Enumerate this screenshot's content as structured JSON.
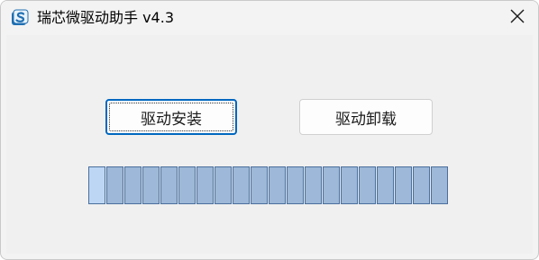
{
  "window": {
    "title": "瑞芯微驱动助手 v4.3",
    "app_icon": "rockchip-logo-icon",
    "close_icon": "close-icon"
  },
  "buttons": {
    "install_label": "驱动安装",
    "uninstall_label": "驱动卸载"
  },
  "progress": {
    "segment_count": 20,
    "active_segments": 1
  },
  "colors": {
    "focus_border": "#0067c0",
    "segment_fill": "#9db8d8",
    "segment_active_fill": "#bcd6f4",
    "segment_border": "#4a6f9c"
  }
}
